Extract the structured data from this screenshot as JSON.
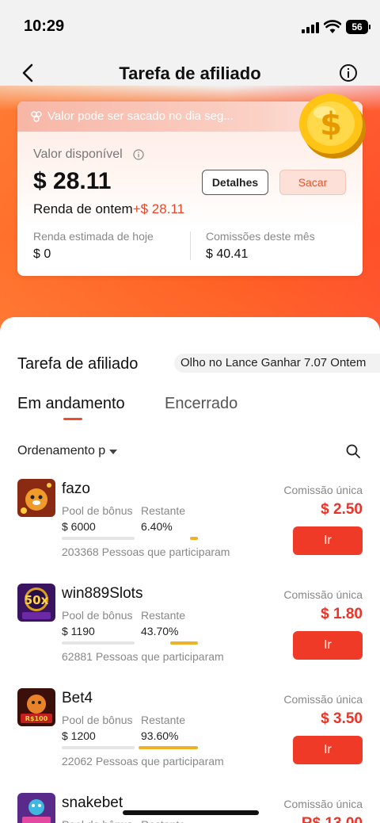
{
  "status_bar": {
    "time": "10:29",
    "battery": "56"
  },
  "nav": {
    "title": "Tarefa de afiliado"
  },
  "wallet": {
    "notice": "Valor pode ser sacado no dia seg...",
    "available_label": "Valor disponível",
    "available_value": "$ 28.11",
    "details_label": "Detalhes",
    "withdraw_label": "Sacar",
    "yesterday_label": "Renda de ontem",
    "yesterday_value": "+$ 28.11",
    "today_label": "Renda estimada de hoje",
    "today_value": "$ 0",
    "month_label": "Comissões deste mês",
    "month_value": "$ 40.41"
  },
  "section": {
    "title": "Tarefa de afiliado",
    "ticker": "Olho no Lance Ganhar 7.07 Ontem"
  },
  "tabs": [
    {
      "label": "Em andamento",
      "active": true
    },
    {
      "label": "Encerrado",
      "active": false
    }
  ],
  "sort": {
    "label": "Ordenamento p"
  },
  "task_labels": {
    "pool": "Pool de bônus",
    "remaining": "Restante",
    "commission": "Comissão única",
    "go": "Ir"
  },
  "tasks": [
    {
      "name": "fazo",
      "pool": "$ 6000",
      "remaining": "6.40%",
      "remaining_fraction": 0.064,
      "participants": "203368 Pessoas que participaram",
      "commission": "$ 2.50",
      "icon": "tiger-game-icon"
    },
    {
      "name": "win889Slots",
      "pool": "$ 1190",
      "remaining": "43.70%",
      "remaining_fraction": 0.437,
      "participants": "62881 Pessoas que participaram",
      "commission": "$ 1.80",
      "icon": "slots-50x-icon"
    },
    {
      "name": "Bet4",
      "pool": "$ 1200",
      "remaining": "93.60%",
      "remaining_fraction": 0.936,
      "participants": "22062 Pessoas que participaram",
      "commission": "$ 3.50",
      "icon": "tiger-bet-icon"
    },
    {
      "name": "snakebet",
      "pool": "",
      "remaining": "",
      "remaining_fraction": 0,
      "participants": "",
      "commission": "R$ 13.00",
      "icon": "snake-game-icon"
    }
  ],
  "colors": {
    "accent": "#ee3a26",
    "progress": "#f0b12a",
    "hero": "#ff5a1f"
  }
}
